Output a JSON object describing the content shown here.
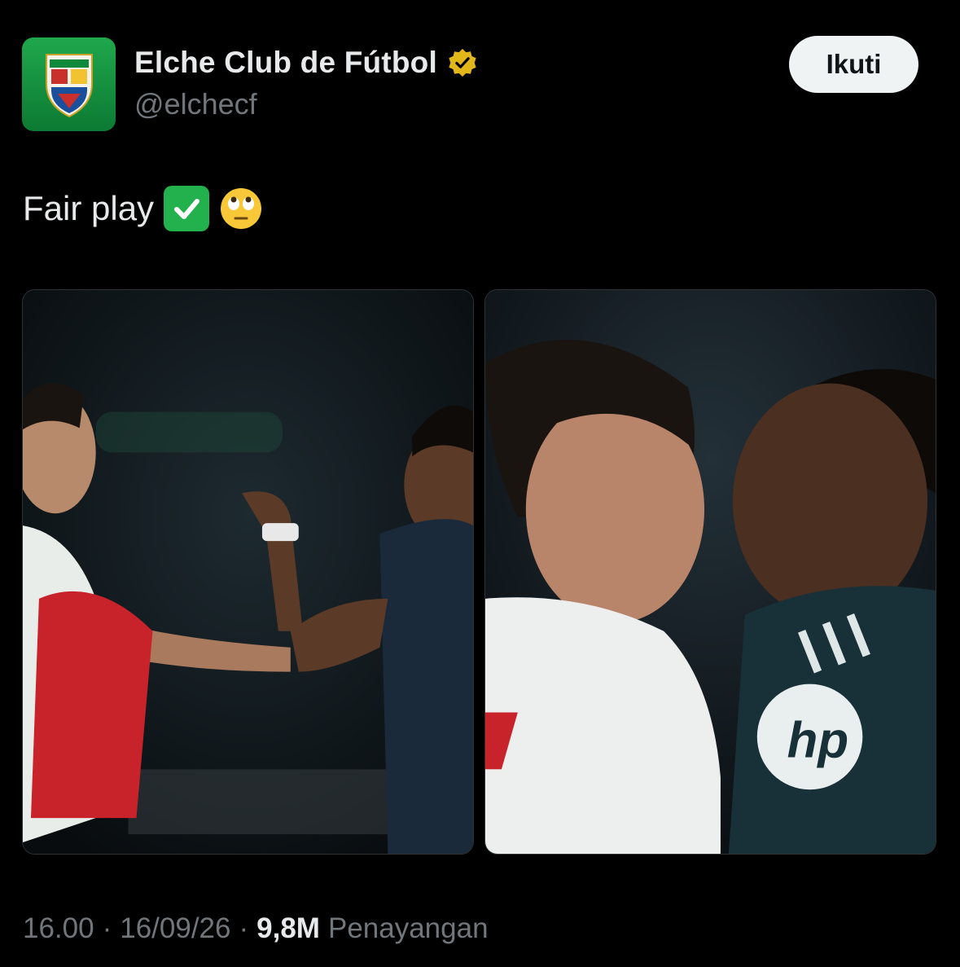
{
  "account": {
    "display_name": "Elche Club de Fútbol",
    "handle": "@elchecf",
    "verified_badge_icon": "verified-gold-badge-icon",
    "avatar_icon": "elche-crest-logo"
  },
  "follow_button": {
    "label": "Ikuti"
  },
  "tweet": {
    "text": "Fair play",
    "emojis": [
      "check-mark-button-icon",
      "face-with-rolling-eyes-icon"
    ]
  },
  "media": [
    {
      "name": "photo-players-confrontation-wide"
    },
    {
      "name": "photo-players-face-to-face-closeup"
    }
  ],
  "meta": {
    "time": "16.00",
    "separator": "·",
    "date": "16/09/26",
    "views_count": "9,8M",
    "views_label": "Penayangan"
  },
  "colors": {
    "background": "#000000",
    "text_primary": "#e7e9ea",
    "text_secondary": "#71767b",
    "avatar_green": "#1fa74c",
    "verified_gold": "#e2b719",
    "follow_button_bg": "#eff3f4"
  }
}
